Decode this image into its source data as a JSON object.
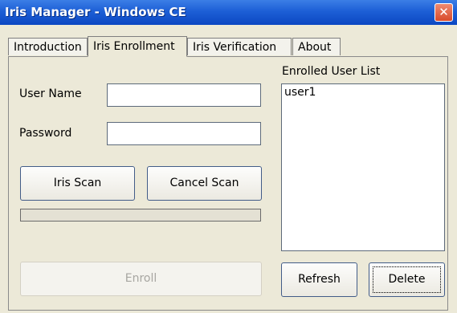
{
  "window": {
    "title": "Iris Manager - Windows CE",
    "close_glyph": "✕"
  },
  "tabs": [
    {
      "label": "Introduction",
      "active": false
    },
    {
      "label": "Iris Enrollment",
      "active": true
    },
    {
      "label": "Iris Verification",
      "active": false
    },
    {
      "label": "About",
      "active": false
    }
  ],
  "enrollment": {
    "username_label": "User Name",
    "username_value": "",
    "password_label": "Password",
    "password_value": "",
    "iris_scan_label": "Iris Scan",
    "cancel_scan_label": "Cancel Scan",
    "scan_progress": 0,
    "enroll_label": "Enroll"
  },
  "user_list": {
    "title": "Enrolled User List",
    "items": [
      "user1"
    ],
    "refresh_label": "Refresh",
    "delete_label": "Delete"
  },
  "colors": {
    "titlebar": "#0b47c2",
    "window_bg": "#ece9d8",
    "close": "#d94a2b"
  }
}
